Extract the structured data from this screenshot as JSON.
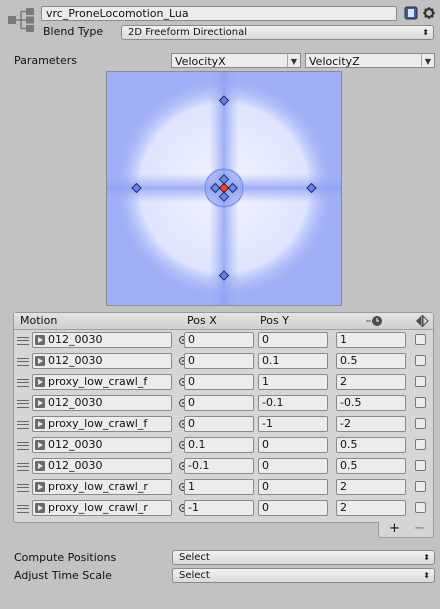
{
  "header": {
    "asset_name": "vrc_ProneLocomotion_Lua",
    "icons": [
      "blend-tree-icon",
      "help-icon",
      "gear-icon"
    ]
  },
  "blend_type": {
    "label": "Blend Type",
    "value": "2D Freeform Directional"
  },
  "parameters": {
    "label": "Parameters",
    "param_x": "VelocityX",
    "param_y": "VelocityZ"
  },
  "colors": {
    "graph_bg": "#a0aff6",
    "graph_glow": "#e6ebff",
    "node": "#6b86e6",
    "active_node": "#e2452a"
  },
  "motion_table": {
    "columns": [
      "Motion",
      "Pos X",
      "Pos Y"
    ],
    "header_icons": [
      "clock-icon",
      "mirror-icon"
    ],
    "rows": [
      {
        "motion": "012_0030",
        "pos_x": "0",
        "pos_y": "0",
        "speed": "1"
      },
      {
        "motion": "012_0030",
        "pos_x": "0",
        "pos_y": "0.1",
        "speed": "0.5"
      },
      {
        "motion": "proxy_low_crawl_f",
        "pos_x": "0",
        "pos_y": "1",
        "speed": "2"
      },
      {
        "motion": "012_0030",
        "pos_x": "0",
        "pos_y": "-0.1",
        "speed": "-0.5"
      },
      {
        "motion": "proxy_low_crawl_f",
        "pos_x": "0",
        "pos_y": "-1",
        "speed": "-2"
      },
      {
        "motion": "012_0030",
        "pos_x": "0.1",
        "pos_y": "0",
        "speed": "0.5"
      },
      {
        "motion": "012_0030",
        "pos_x": "-0.1",
        "pos_y": "0",
        "speed": "0.5"
      },
      {
        "motion": "proxy_low_crawl_r",
        "pos_x": "1",
        "pos_y": "0",
        "speed": "2"
      },
      {
        "motion": "proxy_low_crawl_r",
        "pos_x": "-1",
        "pos_y": "0",
        "speed": "2"
      }
    ],
    "add_label": "+",
    "remove_label": "−"
  },
  "compute_positions": {
    "label": "Compute Positions",
    "value": "Select"
  },
  "adjust_time_scale": {
    "label": "Adjust Time Scale",
    "value": "Select"
  }
}
